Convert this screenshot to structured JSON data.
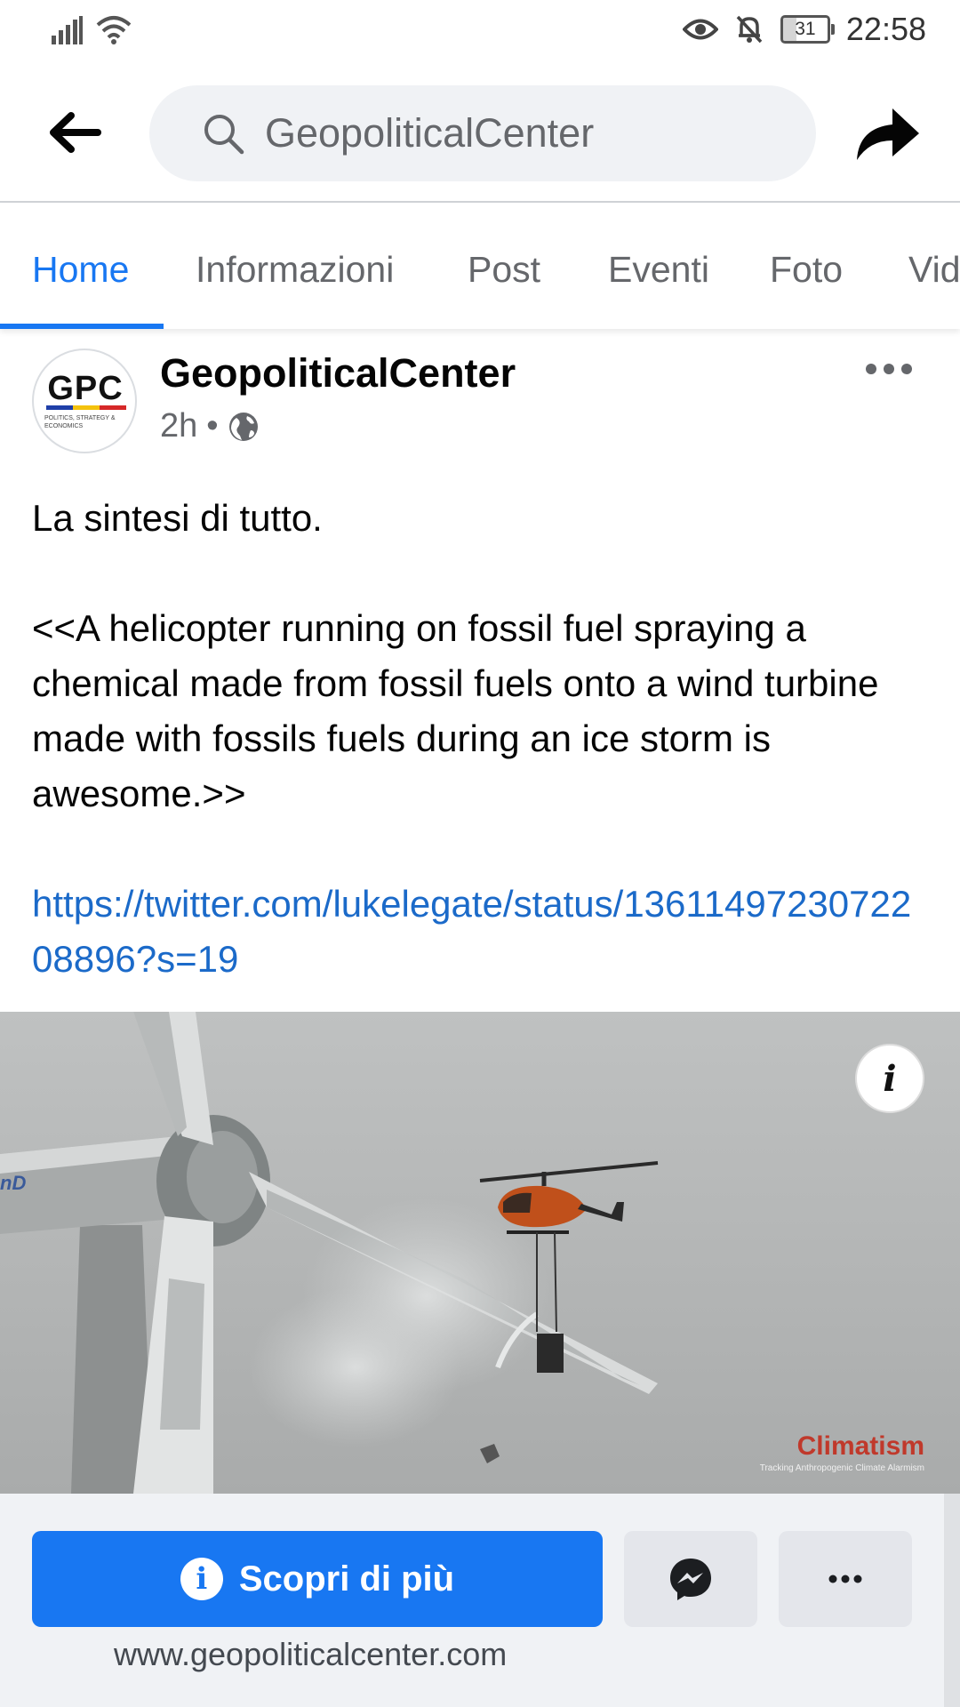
{
  "status_bar": {
    "time": "22:58",
    "battery": "31"
  },
  "header": {
    "search_placeholder": "GeopoliticalCenter"
  },
  "tabs": [
    {
      "label": "Home"
    },
    {
      "label": "Informazioni"
    },
    {
      "label": "Post"
    },
    {
      "label": "Eventi"
    },
    {
      "label": "Foto"
    },
    {
      "label": "Vid"
    }
  ],
  "post": {
    "page_name": "GeopoliticalCenter",
    "avatar_text": "GPC",
    "avatar_tagline": "POLITICS, STRATEGY & ECONOMICS",
    "time": "2h",
    "separator": "•",
    "text_line1": "La sintesi di tutto.",
    "text_quote": "<<A helicopter running on fossil fuel spraying a chemical made from fossil fuels onto a wind turbine made with fossils fuels during an ice storm is awesome.>>",
    "link": "https://twitter.com/lukelegate/status/1361149723072208896?s=19",
    "image": {
      "info_label": "i",
      "turbine_label": "nD",
      "watermark_title": "Climatism",
      "watermark_subtitle": "Tracking Anthropogenic Climate Alarmism"
    }
  },
  "cta": {
    "button_label": "Scopri di più",
    "website": "www.geopoliticalcenter.com"
  },
  "colors": {
    "accent": "#1877f2",
    "link": "#1b6ac9",
    "muted": "#65676b"
  }
}
